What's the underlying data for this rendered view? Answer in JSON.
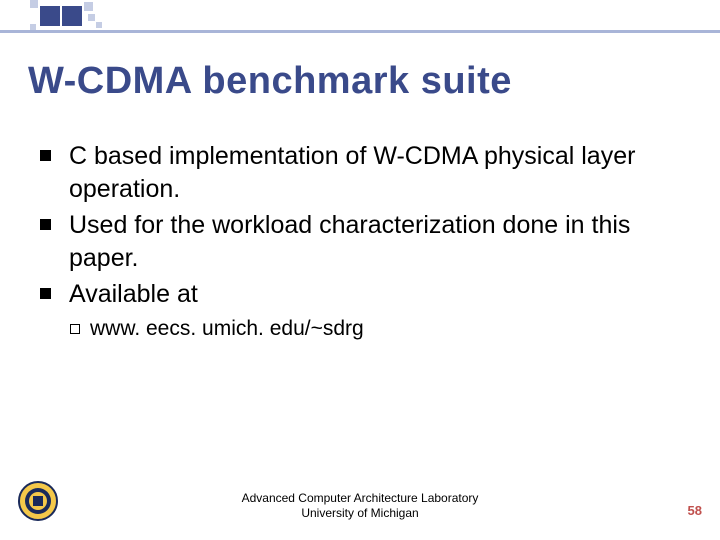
{
  "title": "W-CDMA benchmark suite",
  "bullets": [
    "C based implementation of W-CDMA physical layer operation.",
    "Used for the workload characterization done in this paper.",
    "Available at"
  ],
  "sub_bullet": "www. eecs. umich. edu/~sdrg",
  "footer": {
    "line1": "Advanced Computer Architecture Laboratory",
    "line2": "University of Michigan"
  },
  "page_number": "58"
}
